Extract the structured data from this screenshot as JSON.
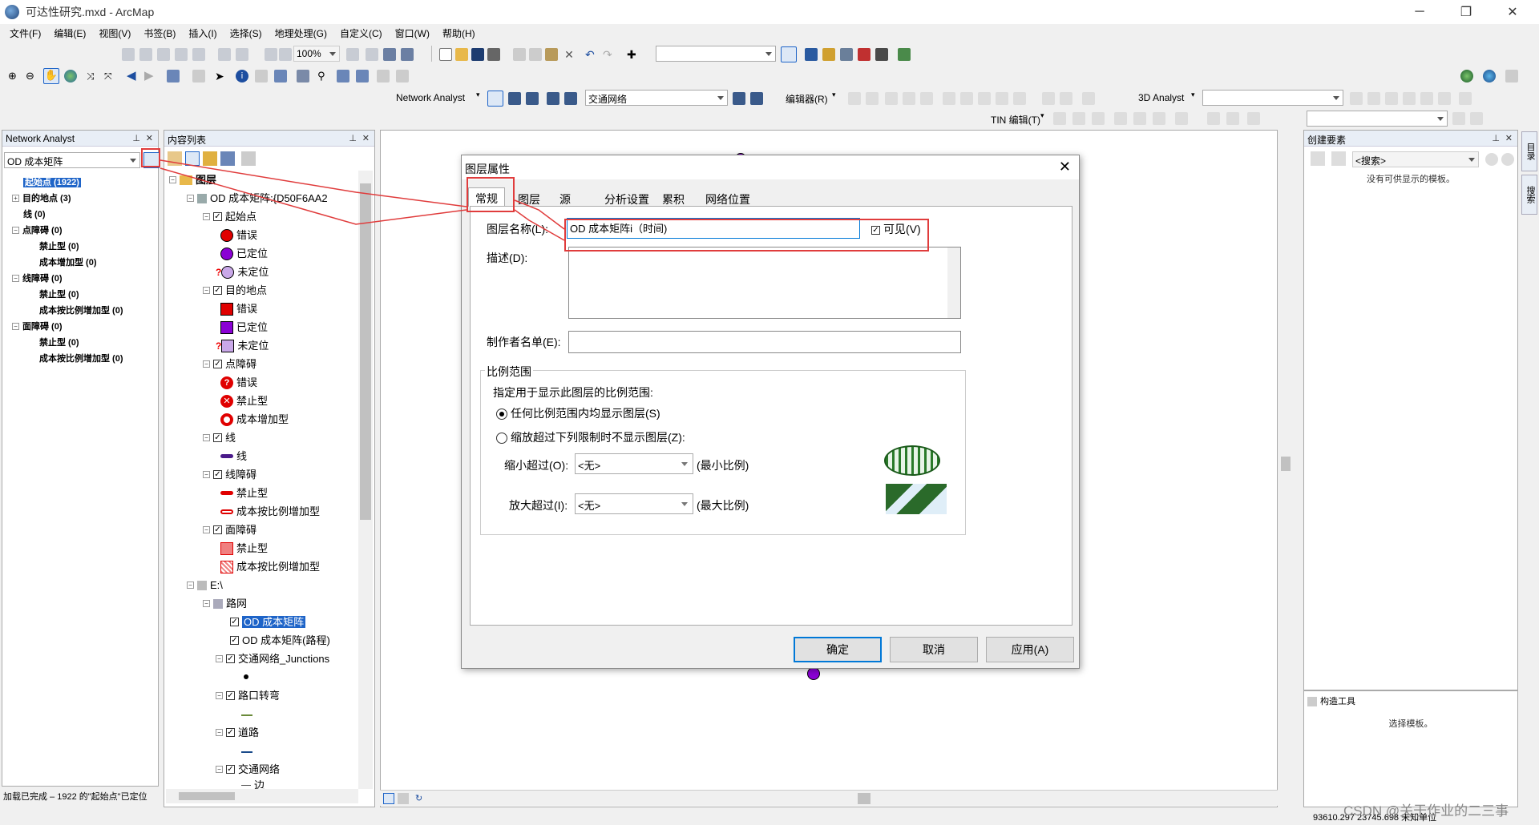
{
  "window": {
    "title": "可达性研究.mxd - ArcMap"
  },
  "menu": [
    "文件(F)",
    "编辑(E)",
    "视图(V)",
    "书签(B)",
    "插入(I)",
    "选择(S)",
    "地理处理(G)",
    "自定义(C)",
    "窗口(W)",
    "帮助(H)"
  ],
  "toolbar": {
    "zoom_value": "100%",
    "network_analyst_label": "Network Analyst",
    "network_combo": "交通网络",
    "editor_label": "编辑器(R)",
    "analyst3d_label": "3D Analyst",
    "tin_label": "TIN 编辑(T)"
  },
  "network_analyst": {
    "title": "Network Analyst",
    "layer_select": "OD 成本矩阵",
    "items": [
      {
        "label": "起始点 (1922)"
      },
      {
        "label": "目的地点 (3)"
      },
      {
        "label": "线 (0)"
      },
      {
        "label": "点障碍 (0)"
      },
      {
        "label": "禁止型 (0)"
      },
      {
        "label": "成本增加型 (0)"
      },
      {
        "label": "线障碍 (0)"
      },
      {
        "label": "禁止型 (0)"
      },
      {
        "label": "成本按比例增加型 (0)"
      },
      {
        "label": "面障碍 (0)"
      },
      {
        "label": "禁止型 (0)"
      },
      {
        "label": "成本按比例增加型 (0)"
      }
    ]
  },
  "toc": {
    "title": "内容列表",
    "root": "图层",
    "od_layer": "OD 成本矩阵:{D50F6AA2",
    "groups": {
      "origins": "起始点",
      "dests": "目的地点",
      "point_barriers": "点障碍",
      "lines": "线",
      "line_barriers": "线障碍",
      "polygon_barriers": "面障碍"
    },
    "sym": {
      "error": "错误",
      "located": "已定位",
      "unlocated": "未定位",
      "restriction": "禁止型",
      "cost_add": "成本增加型",
      "line": "线",
      "cost_scale": "成本按比例增加型"
    },
    "folder": "E:\\",
    "dataset": "路网",
    "layers": [
      "OD 成本矩阵",
      "OD 成本矩阵(路程)",
      "交通网络_Junctions",
      "路口转弯",
      "道路",
      "交通网络"
    ],
    "edge": "边"
  },
  "create_features": {
    "title": "创建要素",
    "search_placeholder": "<搜索>",
    "empty_msg": "没有可供显示的模板。",
    "construct_title": "构造工具",
    "construct_msg": "选择模板。"
  },
  "side_tabs": [
    "目录",
    "搜索"
  ],
  "dialog": {
    "title": "图层属性",
    "tabs": [
      "常规",
      "图层",
      "源",
      "分析设置",
      "累积",
      "网络位置"
    ],
    "layer_name_label": "图层名称(L):",
    "layer_name_value": "OD 成本矩阵i（时间)",
    "visible_label": "可见(V)",
    "desc_label": "描述(D):",
    "credits_label": "制作者名单(E):",
    "scale_group": "比例范围",
    "scale_hint": "指定用于显示此图层的比例范围:",
    "radio_any": "任何比例范围内均显示图层(S)",
    "radio_limit": "缩放超过下列限制时不显示图层(Z):",
    "zoom_out_label": "缩小超过(O):",
    "zoom_out_value": "<无>",
    "min_scale": "(最小比例)",
    "zoom_in_label": "放大超过(I):",
    "zoom_in_value": "<无>",
    "max_scale": "(最大比例)",
    "ok": "确定",
    "cancel": "取消",
    "apply": "应用(A)"
  },
  "status": {
    "left": "加载已完成 – 1922 的\"起始点\"已定位",
    "coords": "93610.297  23745.698 未知单位",
    "watermark": "CSDN @关于作业的二三事"
  },
  "colors": {
    "accent_red": "#e03c3c",
    "selection": "#1e64c8",
    "purple": "#8a00d4"
  }
}
